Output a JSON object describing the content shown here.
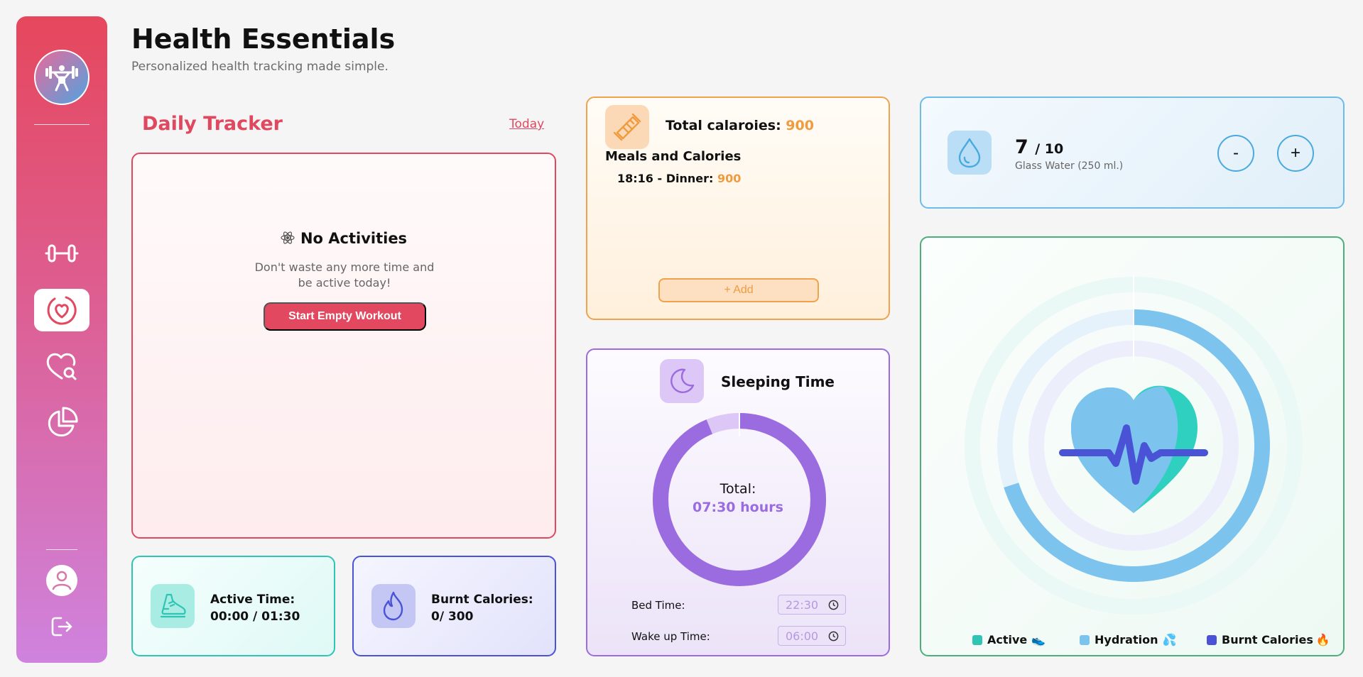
{
  "header": {
    "title": "Health Essentials",
    "subtitle": "Personalized health tracking made simple."
  },
  "sidebar": {
    "items": [
      {
        "icon": "dumbbell-icon"
      },
      {
        "icon": "heart-pulse-icon",
        "active": true
      },
      {
        "icon": "heart-search-icon"
      },
      {
        "icon": "pie-chart-icon"
      }
    ],
    "bottom": [
      {
        "icon": "user-icon"
      },
      {
        "icon": "logout-icon"
      }
    ]
  },
  "daily_tracker": {
    "title": "Daily Tracker",
    "period_link": "Today",
    "empty_title": "No Activities",
    "empty_text": "Don't waste any more time and be active today!",
    "start_button": "Start Empty Workout"
  },
  "active_time": {
    "label": "Active Time:",
    "value": "00:00 / 01:30"
  },
  "burnt_calories": {
    "label": "Burnt Calories:",
    "value": "0/ 300"
  },
  "meals": {
    "total_label": "Total calaroies:",
    "total_value": "900",
    "heading": "Meals and Calories",
    "entries": [
      {
        "text": "18:16 - Dinner:",
        "calories": "900"
      }
    ],
    "add_button": "+ Add"
  },
  "sleep": {
    "title": "Sleeping Time",
    "total_label": "Total:",
    "total_value": "07:30 hours",
    "progress_fraction": 0.9375,
    "bed_label": "Bed Time:",
    "bed_value": "22:30",
    "wake_label": "Wake up Time:",
    "wake_value": "06:00"
  },
  "water": {
    "count": "7",
    "goal": "/ 10",
    "progress_fraction": 0.7,
    "description": "Glass Water (250 ml.)",
    "minus_label": "-",
    "plus_label": "+"
  },
  "overview": {
    "rings": [
      {
        "name": "Active",
        "fraction": 0.0
      },
      {
        "name": "Hydration",
        "fraction": 0.7
      },
      {
        "name": "Burnt Calories",
        "fraction": 0.0
      }
    ],
    "legend": [
      {
        "label": "Active",
        "emoji": "👟"
      },
      {
        "label": "Hydration",
        "emoji": "💦"
      },
      {
        "label": "Burnt Calories",
        "emoji": "🔥"
      }
    ]
  },
  "colors": {
    "primary": "#e2485f",
    "teal": "#2fc4b4",
    "indigo": "#4a53d6",
    "orange": "#ef9b3f",
    "purple": "#9b6ce0",
    "sky": "#7cc3ee",
    "green": "#4cae7a"
  }
}
